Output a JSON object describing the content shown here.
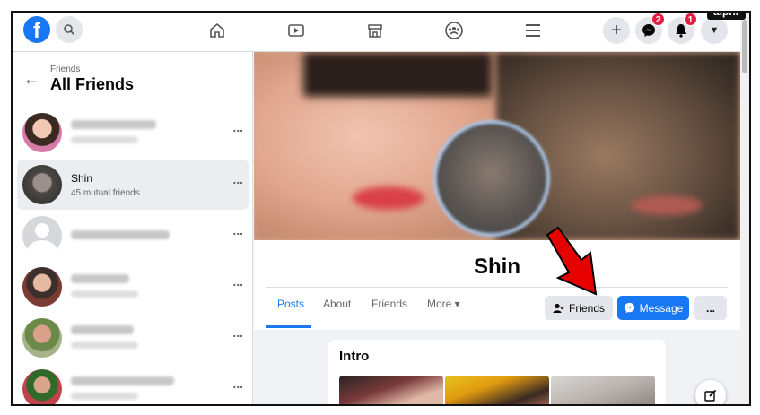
{
  "watermark": "alphr",
  "topbar": {
    "logo_letter": "f",
    "messenger_badge": "2",
    "notifications_badge": "1",
    "icons": [
      "home-icon",
      "watch-icon",
      "marketplace-icon",
      "groups-icon",
      "menu-icon",
      "plus-icon",
      "messenger-icon",
      "bell-icon",
      "caret-down-icon"
    ]
  },
  "sidebar": {
    "breadcrumb": "Friends",
    "title": "All Friends",
    "selected_friend": {
      "name": "Shin",
      "mutual": "45 mutual friends"
    },
    "more_label": "..."
  },
  "profile": {
    "name": "Shin",
    "tabs": [
      "Posts",
      "About",
      "Friends",
      "More ▾"
    ],
    "friends_button": "Friends",
    "message_button": "Message",
    "more_button": "..."
  },
  "intro": {
    "title": "Intro"
  },
  "colors": {
    "accent": "#1877f2",
    "badge": "#e41e3f",
    "arrow": "#e60000"
  }
}
